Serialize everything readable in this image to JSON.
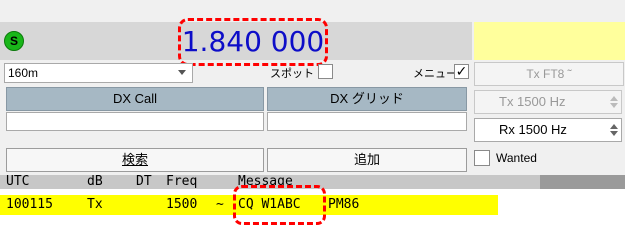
{
  "status": {
    "led_letter": "S",
    "led_color": "#19b619"
  },
  "frequency": {
    "display": "1.840 000",
    "color": "#0d0dc8"
  },
  "band": {
    "selected": "160m"
  },
  "spot": {
    "label": "スポット",
    "checked": false
  },
  "menu": {
    "label": "メニュー",
    "checked": true,
    "mark": "✓"
  },
  "dx": {
    "call_button": "DX Call",
    "grid_button": "DX グリッド",
    "call_value": "",
    "grid_value": ""
  },
  "actions": {
    "search_label": "検索",
    "add_label": "追加"
  },
  "tx_mode": {
    "label": "Tx FT8 ˜"
  },
  "tx_freq": {
    "label": "Tx  1500  Hz"
  },
  "rx_freq": {
    "label": "Rx  1500  Hz"
  },
  "wanted": {
    "label": "Wanted",
    "checked": false
  },
  "table": {
    "headers": {
      "utc": "UTC",
      "db": "dB",
      "dt": "DT",
      "freq": "Freq",
      "message": "Message"
    },
    "rows": [
      {
        "utc": "100115",
        "db": "Tx",
        "dt": "",
        "freq": "1500",
        "sep": "~",
        "message_call": "CQ W1ABC",
        "message_rest": "PM86",
        "highlight": "#ffff00"
      }
    ]
  },
  "annotation_color": "#ff0000"
}
